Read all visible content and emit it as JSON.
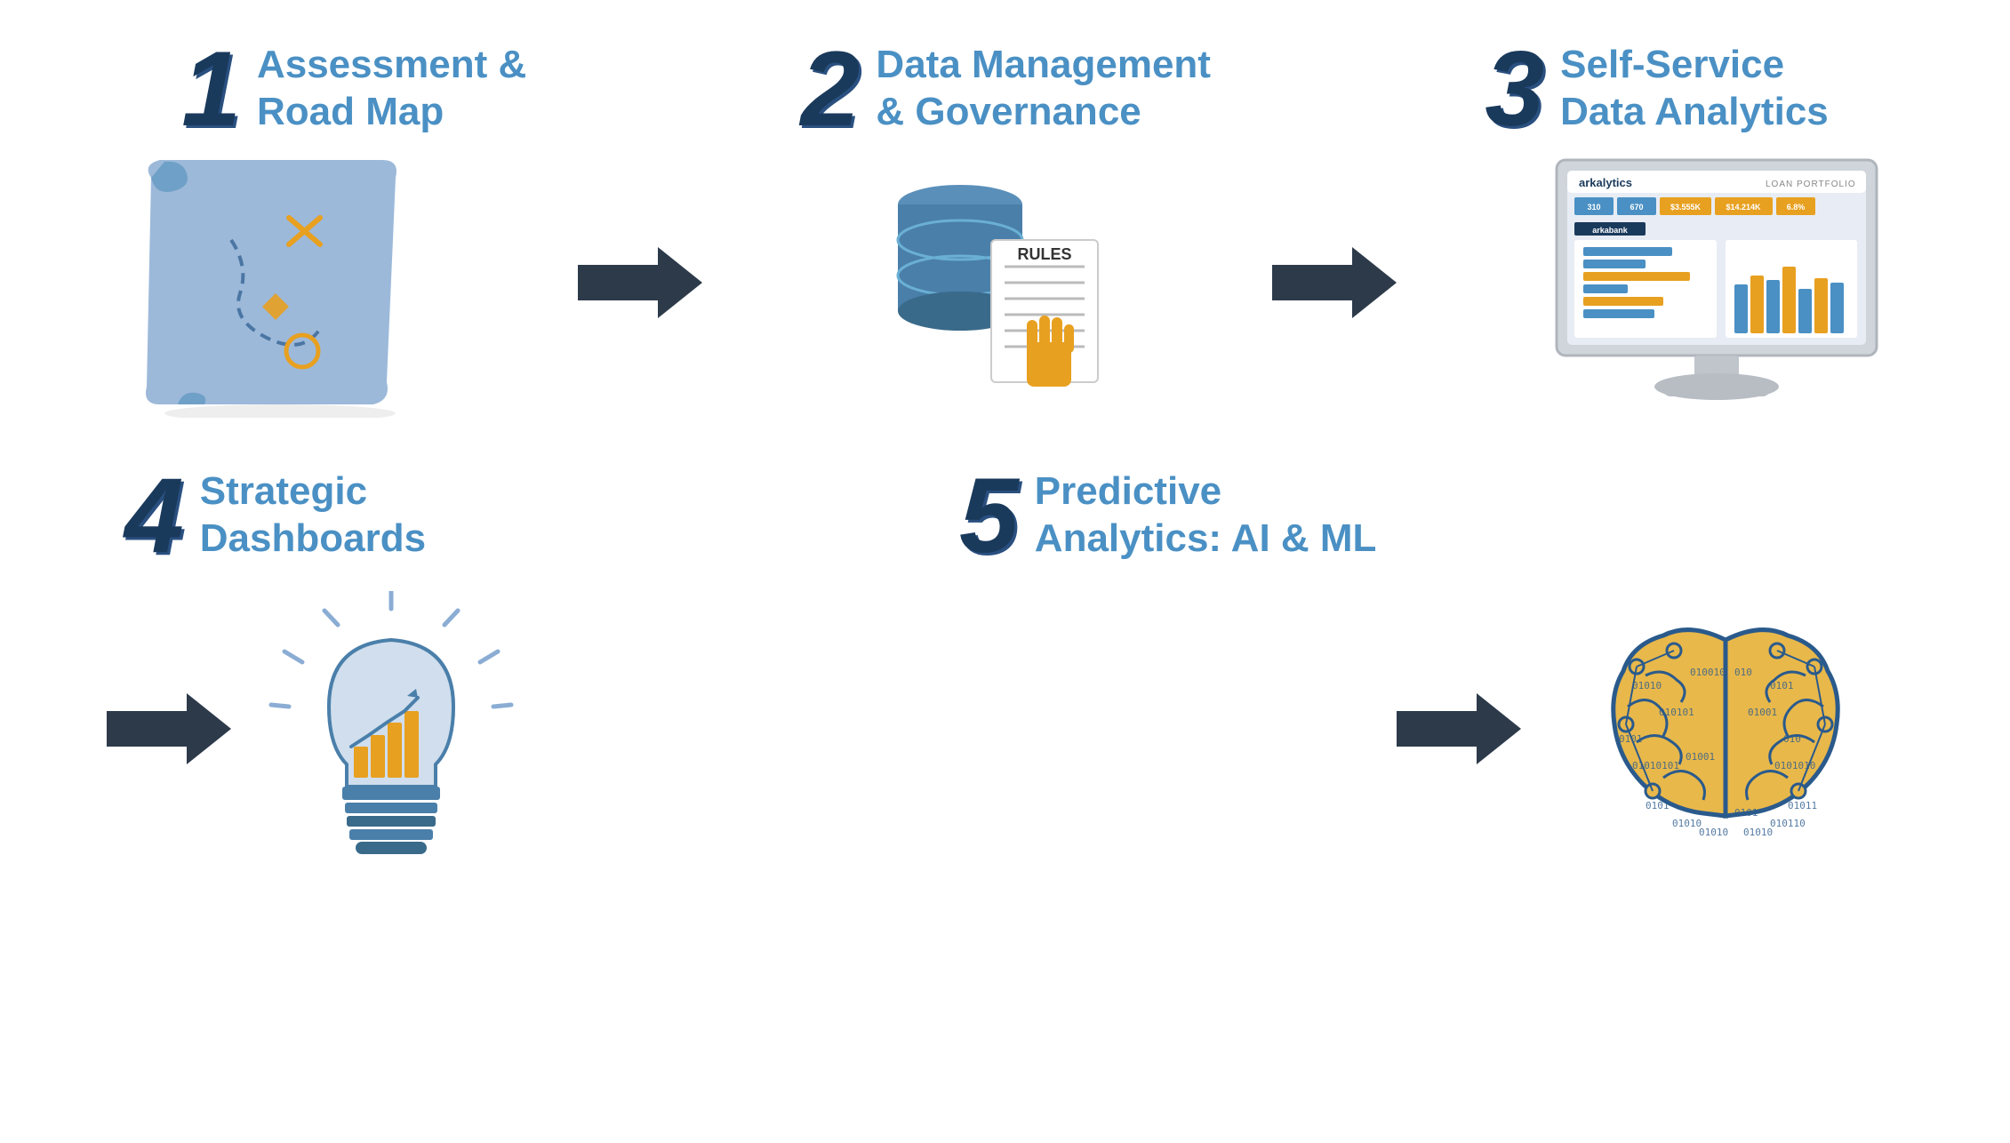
{
  "steps": [
    {
      "number": "1",
      "label_line1": "Assessment &",
      "label_line2": "Road Map"
    },
    {
      "number": "2",
      "label_line1": "Data Management",
      "label_line2": "& Governance"
    },
    {
      "number": "3",
      "label_line1": "Self-Service",
      "label_line2": "Data Analytics"
    },
    {
      "number": "4",
      "label_line1": "Strategic",
      "label_line2": "Dashboards"
    },
    {
      "number": "5",
      "label_line1": "Predictive",
      "label_line2": "Analytics: AI & ML"
    }
  ],
  "monitor": {
    "brand": "arkalytics",
    "title": "LOAN PORTFOLIO",
    "stats": [
      "310",
      "670",
      "$3.555K",
      "$14.214K",
      "6.8%"
    ]
  },
  "colors": {
    "dark_blue": "#1a3a5c",
    "medium_blue": "#2a5a8c",
    "accent_blue": "#4a90c4",
    "light_blue": "#7ab8d9",
    "gold": "#e8a020",
    "light_map": "#8badd4",
    "arrow_dark": "#2d3a4a",
    "brain_gold": "#e8b84b",
    "brain_outline": "#2a5a8c"
  }
}
